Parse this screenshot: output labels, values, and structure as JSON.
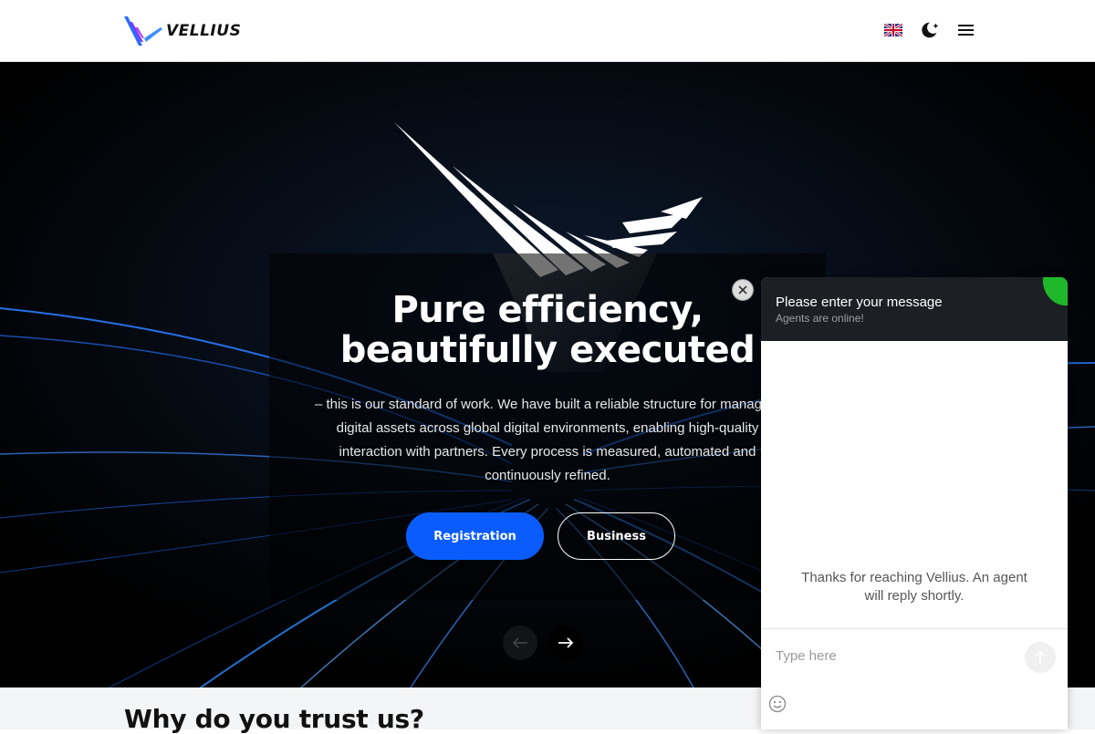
{
  "header": {
    "brand": "VELLIUS",
    "icons": [
      "uk-flag-icon",
      "theme-toggle-icon",
      "menu-icon"
    ]
  },
  "hero": {
    "title_line1": "Pure efficiency,",
    "title_line2": "beautifully executed",
    "text": "– this is our standard of work. We have built a reliable structure for managing digital assets across global digital environments, enabling high-quality interaction with partners. Every process is measured, automated and continuously refined.",
    "registration_label": "Registration",
    "business_label": "Business",
    "accent_color": "#0a5cff"
  },
  "section": {
    "heading": "Why do you trust us?"
  },
  "chat": {
    "title": "Please enter your message",
    "subtitle": "Agents are online!",
    "message": "Thanks for reaching Vellius. An agent will reply shortly.",
    "input_placeholder": "Type here",
    "status_color": "#1fb82a",
    "header_color": "#1c1f24"
  }
}
